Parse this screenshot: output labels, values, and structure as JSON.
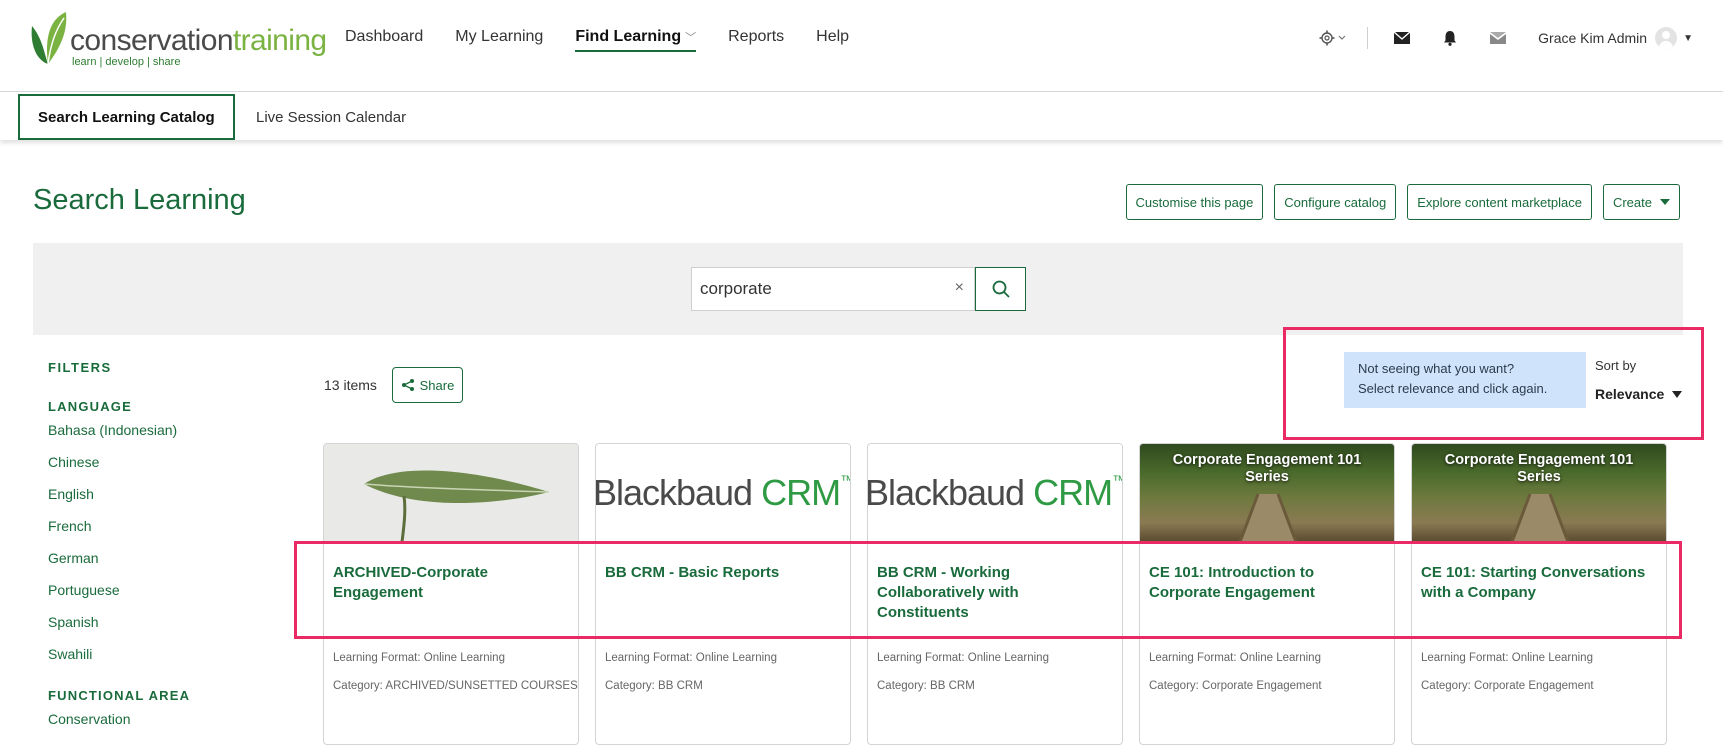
{
  "brand": {
    "word1": "conservation",
    "word2": "training",
    "tagline": "learn | develop | share"
  },
  "nav": [
    {
      "label": "Dashboard"
    },
    {
      "label": "My Learning"
    },
    {
      "label": "Find Learning"
    },
    {
      "label": "Reports"
    },
    {
      "label": "Help"
    }
  ],
  "user": {
    "name": "Grace Kim Admin"
  },
  "subnav": {
    "tab1": "Search Learning Catalog",
    "tab2": "Live Session Calendar"
  },
  "page": {
    "title": "Search Learning"
  },
  "actions": {
    "customise": "Customise this page",
    "configure": "Configure catalog",
    "explore": "Explore content marketplace",
    "create": "Create"
  },
  "search": {
    "value": "corporate",
    "clear": "×"
  },
  "filters": {
    "heading": "FILTERS",
    "language": {
      "heading": "LANGUAGE",
      "items": [
        "Bahasa (Indonesian)",
        "Chinese",
        "English",
        "French",
        "German",
        "Portuguese",
        "Spanish",
        "Swahili"
      ]
    },
    "functional_area": {
      "heading": "FUNCTIONAL AREA",
      "items": [
        "Conservation"
      ]
    }
  },
  "results": {
    "count": "13 items",
    "share": "Share",
    "tip_line1": "Not seeing what you want?",
    "tip_line2": "Select relevance and click again.",
    "sort_label": "Sort by",
    "sort_value": "Relevance"
  },
  "cards": [
    {
      "title": "ARCHIVED-Corporate Engagement",
      "format": "Learning Format: Online Learning",
      "category": "Category: ARCHIVED/SUNSETTED COURSES"
    },
    {
      "thumb_a": "Blackbaud ",
      "thumb_b": "CRM",
      "thumb_tm": "™",
      "title": "BB CRM - Basic Reports",
      "format": "Learning Format: Online Learning",
      "category": "Category: BB CRM"
    },
    {
      "thumb_a": "Blackbaud ",
      "thumb_b": "CRM",
      "thumb_tm": "™",
      "title": "BB CRM - Working Collaboratively with Constituents",
      "format": "Learning Format: Online Learning",
      "category": "Category: BB CRM"
    },
    {
      "thumb_title": "Corporate Engagement 101 Series",
      "title": "CE 101: Introduction to Corporate Engagement",
      "format": "Learning Format: Online Learning",
      "category": "Category: Corporate Engagement"
    },
    {
      "thumb_title": "Corporate Engagement 101 Series",
      "title": "CE 101: Starting Conversations with a Company",
      "format": "Learning Format: Online Learning",
      "category": "Category: Corporate Engagement"
    }
  ],
  "colors": {
    "brand_green": "#1a6b3c",
    "highlight": "#ea2a64",
    "tip_bg": "#cfe4fb"
  }
}
